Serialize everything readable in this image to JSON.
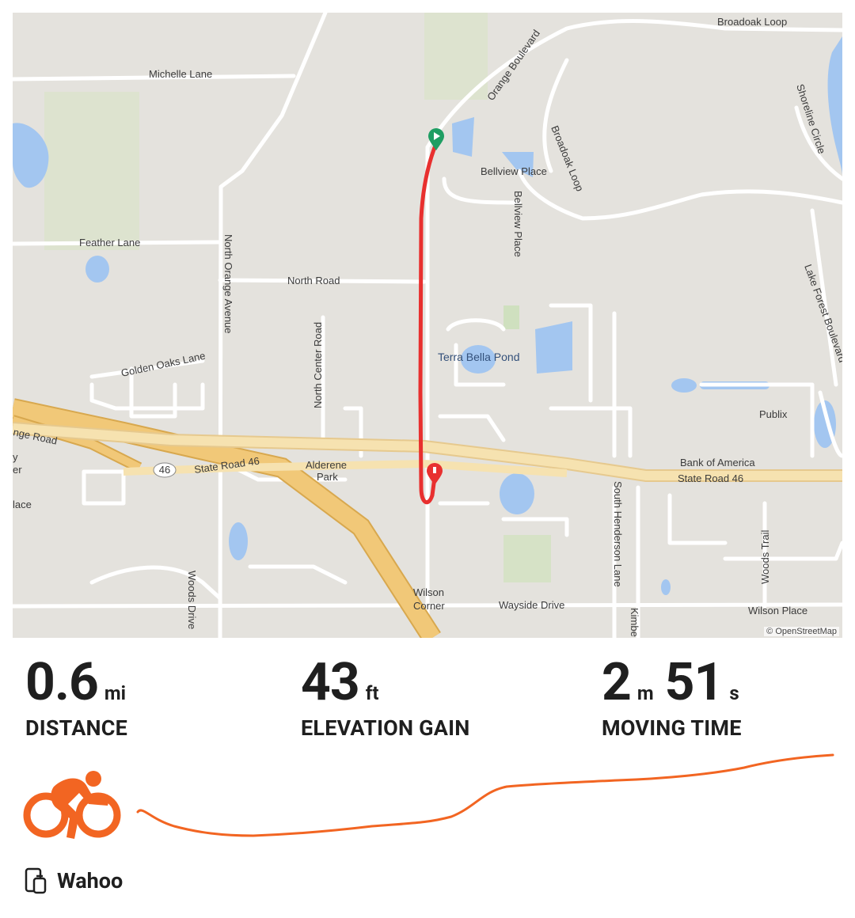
{
  "map": {
    "attribution": "© OpenStreetMap",
    "labels": {
      "michelle_lane": "Michelle Lane",
      "feather_lane": "Feather Lane",
      "north_road": "North Road",
      "north_orange_avenue": "North Orange Avenue",
      "north_center_road": "North Center Road",
      "golden_oaks_lane": "Golden Oaks Lane",
      "orange_boulevard": "Orange Boulevard",
      "bellview_place": "Bellview Place",
      "broadoak_loop_top": "Broadoak Loop",
      "broadoak_loop": "Broadoak Loop",
      "shoreline_circle": "Shoreline Circle",
      "lake_forest_boulevard": "Lake Forest Boulevard",
      "terra_bella_pond": "Terra Bella Pond",
      "publix": "Publix",
      "bank_of_america": "Bank of America",
      "state_road_46_left": "State Road 46",
      "state_road_46_right": "State Road 46",
      "shield_46": "46",
      "orange_road": "nge Road",
      "alderene": "Alderene",
      "park": "Park",
      "south_henderson_lane": "South Henderson Lane",
      "woods_trail": "Woods Trail",
      "woods_drive": "Woods Drive",
      "wilson": "Wilson",
      "corner": "Corner",
      "wayside_drive": "Wayside Drive",
      "wilson_place": "Wilson Place",
      "kimbe": "Kimbe",
      "left_y": "y",
      "left_er": "er",
      "left_lace": "lace"
    },
    "colors": {
      "background": "#e4e2dd",
      "road": "#ffffff",
      "water": "#a3c6f0",
      "highway": "#f1c878",
      "route": "#e8302f",
      "start_pin": "#1e9e63",
      "end_pin": "#e8302f"
    },
    "start_icon": "start-pin-icon",
    "end_icon": "end-pin-icon"
  },
  "stats": {
    "distance": {
      "value": "0.6",
      "unit": "mi",
      "label": "DISTANCE"
    },
    "elevation": {
      "value": "43",
      "unit": "ft",
      "label": "ELEVATION GAIN"
    },
    "moving_time": {
      "minutes": "2",
      "minutes_unit": "m",
      "seconds": "51",
      "seconds_unit": "s",
      "label": "MOVING TIME"
    }
  },
  "activity": {
    "icon": "cycling-icon",
    "color": "#f26522"
  },
  "device": {
    "icon": "watch-phone-icon",
    "label": "Wahoo"
  }
}
